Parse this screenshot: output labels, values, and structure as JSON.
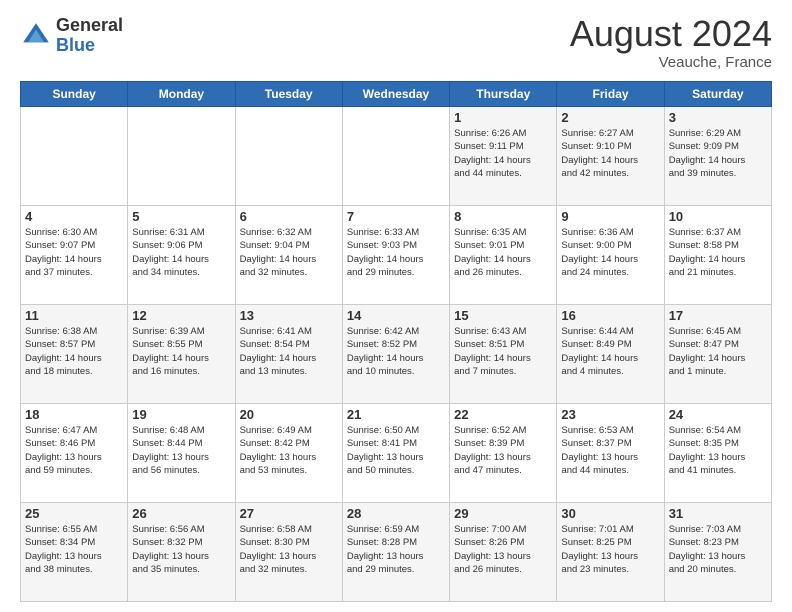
{
  "header": {
    "logo": {
      "general": "General",
      "blue": "Blue"
    },
    "month_year": "August 2024",
    "location": "Veauche, France"
  },
  "days_of_week": [
    "Sunday",
    "Monday",
    "Tuesday",
    "Wednesday",
    "Thursday",
    "Friday",
    "Saturday"
  ],
  "weeks": [
    [
      {
        "day": "",
        "info": ""
      },
      {
        "day": "",
        "info": ""
      },
      {
        "day": "",
        "info": ""
      },
      {
        "day": "",
        "info": ""
      },
      {
        "day": "1",
        "info": "Sunrise: 6:26 AM\nSunset: 9:11 PM\nDaylight: 14 hours\nand 44 minutes."
      },
      {
        "day": "2",
        "info": "Sunrise: 6:27 AM\nSunset: 9:10 PM\nDaylight: 14 hours\nand 42 minutes."
      },
      {
        "day": "3",
        "info": "Sunrise: 6:29 AM\nSunset: 9:09 PM\nDaylight: 14 hours\nand 39 minutes."
      }
    ],
    [
      {
        "day": "4",
        "info": "Sunrise: 6:30 AM\nSunset: 9:07 PM\nDaylight: 14 hours\nand 37 minutes."
      },
      {
        "day": "5",
        "info": "Sunrise: 6:31 AM\nSunset: 9:06 PM\nDaylight: 14 hours\nand 34 minutes."
      },
      {
        "day": "6",
        "info": "Sunrise: 6:32 AM\nSunset: 9:04 PM\nDaylight: 14 hours\nand 32 minutes."
      },
      {
        "day": "7",
        "info": "Sunrise: 6:33 AM\nSunset: 9:03 PM\nDaylight: 14 hours\nand 29 minutes."
      },
      {
        "day": "8",
        "info": "Sunrise: 6:35 AM\nSunset: 9:01 PM\nDaylight: 14 hours\nand 26 minutes."
      },
      {
        "day": "9",
        "info": "Sunrise: 6:36 AM\nSunset: 9:00 PM\nDaylight: 14 hours\nand 24 minutes."
      },
      {
        "day": "10",
        "info": "Sunrise: 6:37 AM\nSunset: 8:58 PM\nDaylight: 14 hours\nand 21 minutes."
      }
    ],
    [
      {
        "day": "11",
        "info": "Sunrise: 6:38 AM\nSunset: 8:57 PM\nDaylight: 14 hours\nand 18 minutes."
      },
      {
        "day": "12",
        "info": "Sunrise: 6:39 AM\nSunset: 8:55 PM\nDaylight: 14 hours\nand 16 minutes."
      },
      {
        "day": "13",
        "info": "Sunrise: 6:41 AM\nSunset: 8:54 PM\nDaylight: 14 hours\nand 13 minutes."
      },
      {
        "day": "14",
        "info": "Sunrise: 6:42 AM\nSunset: 8:52 PM\nDaylight: 14 hours\nand 10 minutes."
      },
      {
        "day": "15",
        "info": "Sunrise: 6:43 AM\nSunset: 8:51 PM\nDaylight: 14 hours\nand 7 minutes."
      },
      {
        "day": "16",
        "info": "Sunrise: 6:44 AM\nSunset: 8:49 PM\nDaylight: 14 hours\nand 4 minutes."
      },
      {
        "day": "17",
        "info": "Sunrise: 6:45 AM\nSunset: 8:47 PM\nDaylight: 14 hours\nand 1 minute."
      }
    ],
    [
      {
        "day": "18",
        "info": "Sunrise: 6:47 AM\nSunset: 8:46 PM\nDaylight: 13 hours\nand 59 minutes."
      },
      {
        "day": "19",
        "info": "Sunrise: 6:48 AM\nSunset: 8:44 PM\nDaylight: 13 hours\nand 56 minutes."
      },
      {
        "day": "20",
        "info": "Sunrise: 6:49 AM\nSunset: 8:42 PM\nDaylight: 13 hours\nand 53 minutes."
      },
      {
        "day": "21",
        "info": "Sunrise: 6:50 AM\nSunset: 8:41 PM\nDaylight: 13 hours\nand 50 minutes."
      },
      {
        "day": "22",
        "info": "Sunrise: 6:52 AM\nSunset: 8:39 PM\nDaylight: 13 hours\nand 47 minutes."
      },
      {
        "day": "23",
        "info": "Sunrise: 6:53 AM\nSunset: 8:37 PM\nDaylight: 13 hours\nand 44 minutes."
      },
      {
        "day": "24",
        "info": "Sunrise: 6:54 AM\nSunset: 8:35 PM\nDaylight: 13 hours\nand 41 minutes."
      }
    ],
    [
      {
        "day": "25",
        "info": "Sunrise: 6:55 AM\nSunset: 8:34 PM\nDaylight: 13 hours\nand 38 minutes."
      },
      {
        "day": "26",
        "info": "Sunrise: 6:56 AM\nSunset: 8:32 PM\nDaylight: 13 hours\nand 35 minutes."
      },
      {
        "day": "27",
        "info": "Sunrise: 6:58 AM\nSunset: 8:30 PM\nDaylight: 13 hours\nand 32 minutes."
      },
      {
        "day": "28",
        "info": "Sunrise: 6:59 AM\nSunset: 8:28 PM\nDaylight: 13 hours\nand 29 minutes."
      },
      {
        "day": "29",
        "info": "Sunrise: 7:00 AM\nSunset: 8:26 PM\nDaylight: 13 hours\nand 26 minutes."
      },
      {
        "day": "30",
        "info": "Sunrise: 7:01 AM\nSunset: 8:25 PM\nDaylight: 13 hours\nand 23 minutes."
      },
      {
        "day": "31",
        "info": "Sunrise: 7:03 AM\nSunset: 8:23 PM\nDaylight: 13 hours\nand 20 minutes."
      }
    ]
  ]
}
